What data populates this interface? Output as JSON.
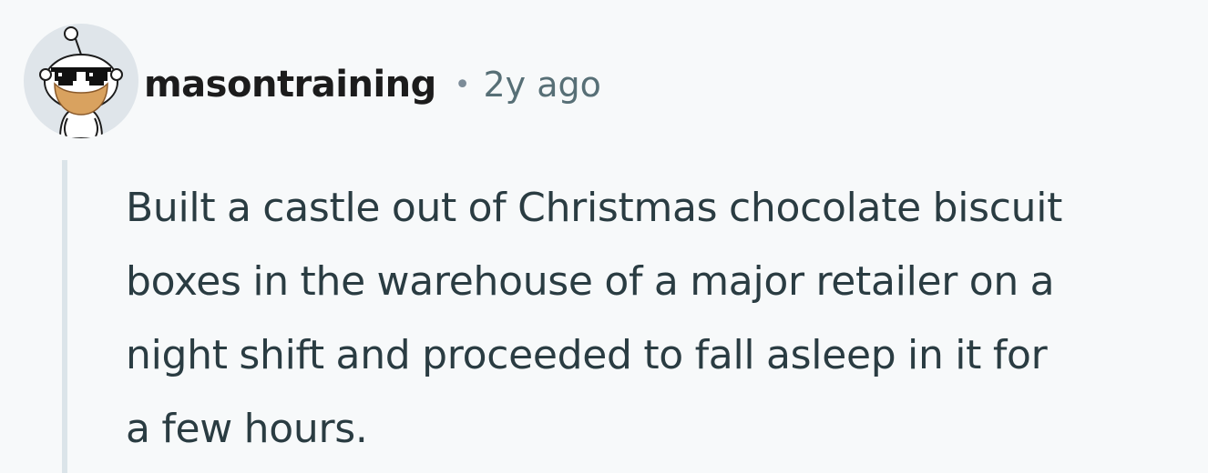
{
  "comment": {
    "author": "masontraining",
    "separator": "•",
    "timestamp": "2y ago",
    "avatar_icon": "snoo-sunglasses-avatar-icon",
    "body_lines": [
      "Built a castle out of Christmas chocolate biscuit",
      "boxes in the warehouse of a major retailer on a",
      "night shift and proceeded to fall asleep in it for",
      "a few hours."
    ]
  },
  "colors": {
    "background": "#f7f9fa",
    "username": "#1c1c1c",
    "timestamp": "#576f76",
    "body_text": "#2a3c42",
    "thread_line": "#dbe4e9"
  }
}
